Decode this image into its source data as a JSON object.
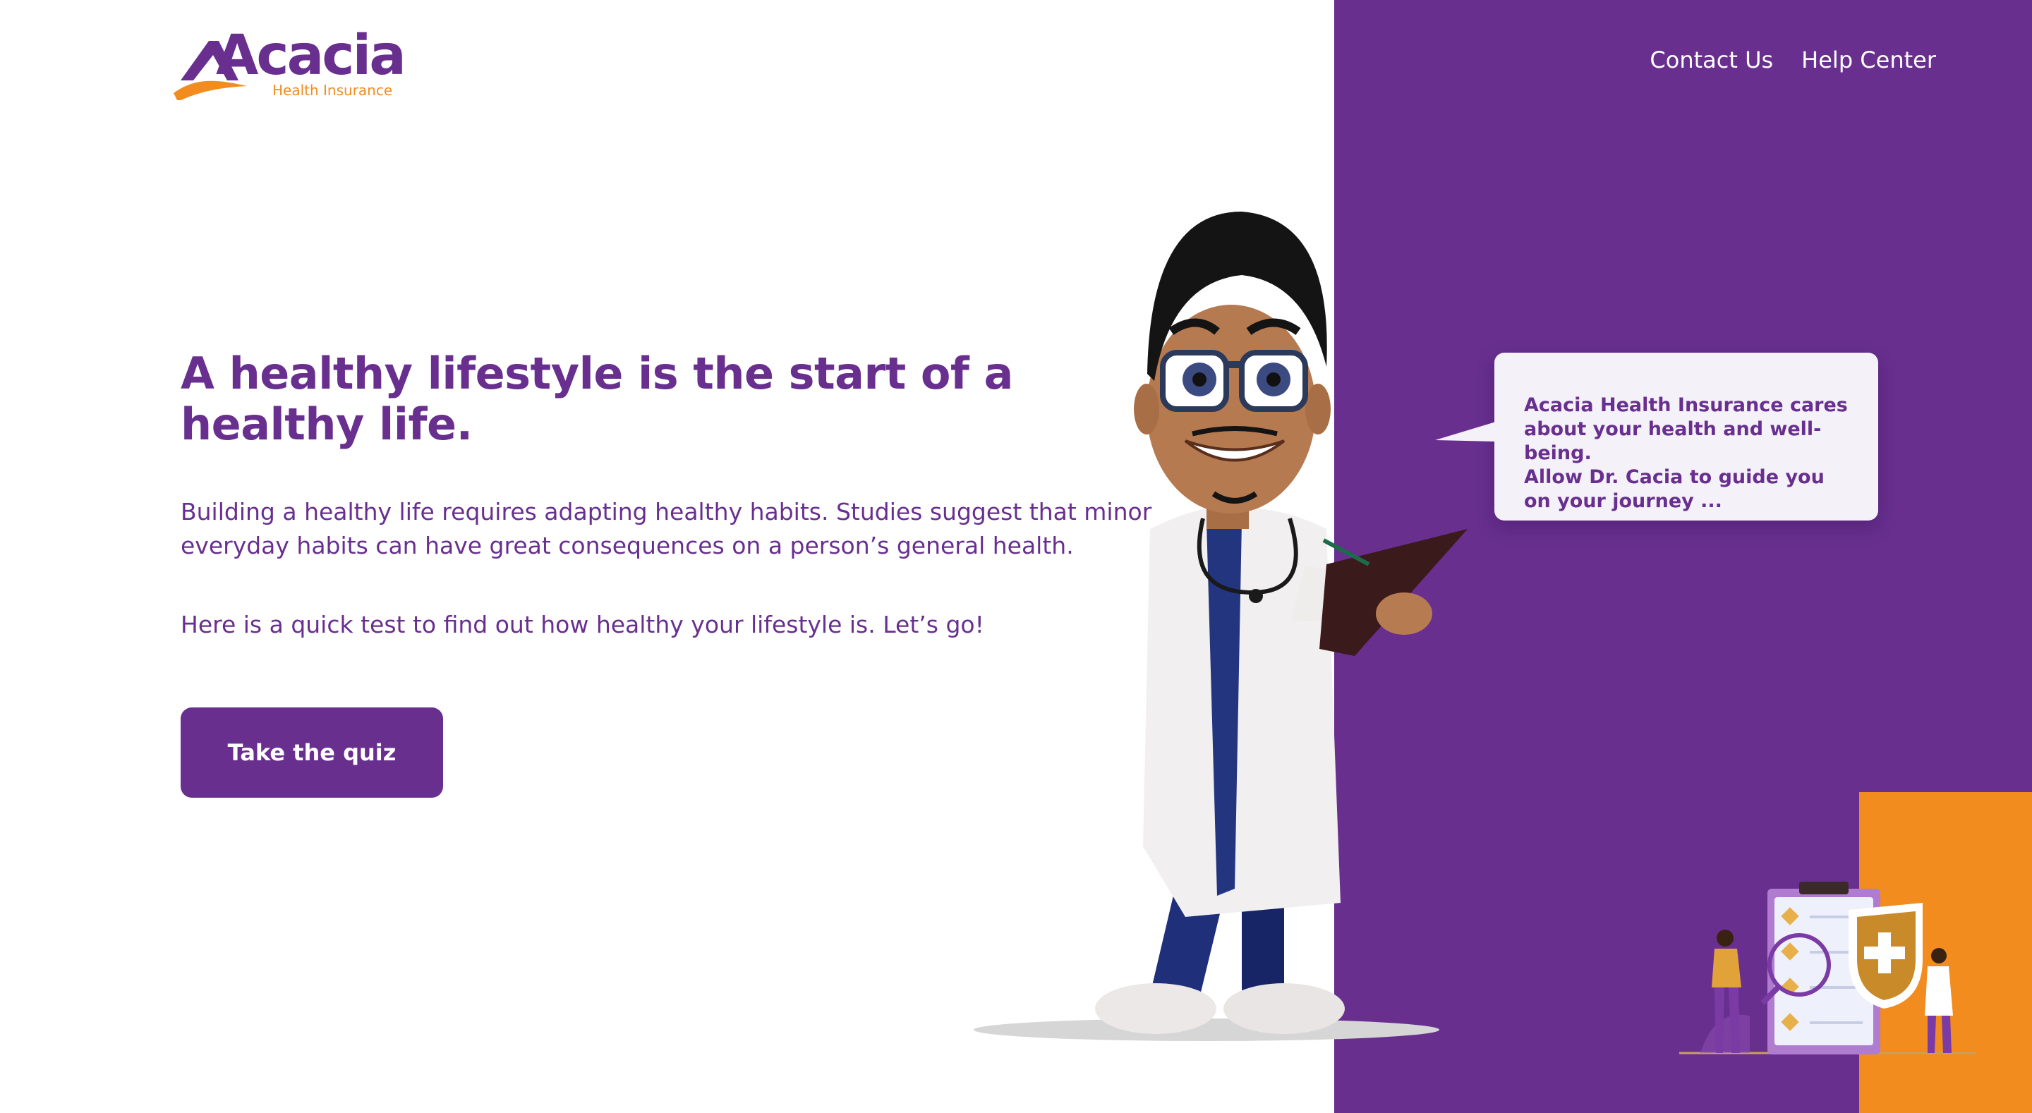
{
  "brand": {
    "name": "Acacia",
    "tagline": "Health Insurance"
  },
  "nav": {
    "items": [
      "Contact Us",
      "Help Center"
    ]
  },
  "hero": {
    "headline": "A healthy lifestyle is the start of a healthy life.",
    "paragraph1": "Building a healthy life requires adapting healthy habits. Studies suggest that minor everyday habits can have great consequences on a person’s general health.",
    "paragraph2": "Here is a quick test to find out how healthy your lifestyle is. Let’s go!",
    "cta_label": "Take the quiz"
  },
  "speech_bubble": {
    "lines": [
      "Acacia Health Insurance cares",
      "about your health and well-being.",
      "Allow Dr. Cacia to guide you",
      "on your journey ..."
    ]
  },
  "colors": {
    "brand_purple": "#682f8f",
    "accent_orange": "#f28c1e",
    "white": "#ffffff",
    "bubble_bg": "#f4f1f9"
  },
  "icons": [
    "acacia-logo-icon",
    "doctor-illustration",
    "health-shield-illustration"
  ]
}
